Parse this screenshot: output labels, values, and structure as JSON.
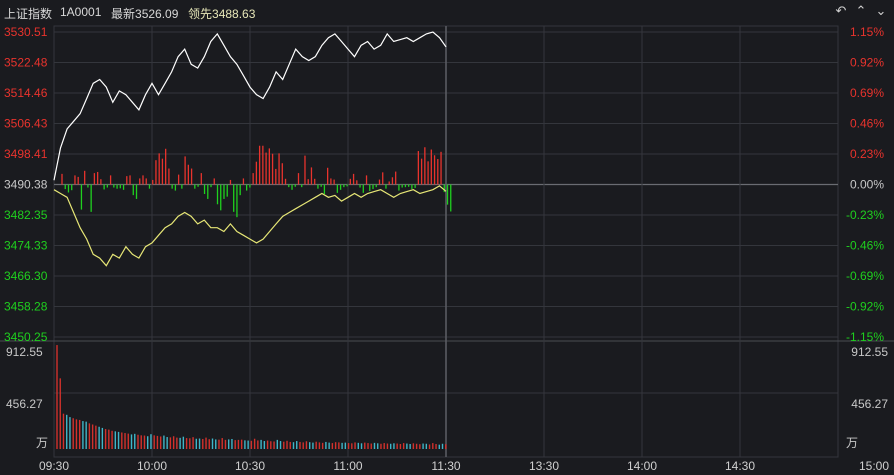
{
  "header": {
    "index_name": "上证指数",
    "code": "1A0001",
    "latest_label": "最新",
    "latest_value": "3526.09",
    "leading_label": "领先",
    "leading_value": "3488.63",
    "icons": [
      "undo-icon",
      "chevron-up-icon",
      "chevron-down-icon"
    ]
  },
  "colors": {
    "background": "#1a1b1f",
    "up": "#e8332d",
    "down": "#1fd01f",
    "price_line": "#ffffff",
    "leading_line": "#e6e676",
    "grid": "#34363c",
    "volume_up": "#d2312c",
    "volume_down": "#3fb6c8",
    "header_value": "#e7e7b8"
  },
  "chart_data": {
    "type": "line",
    "price_axis": {
      "ticks": [
        "3530.51",
        "3522.48",
        "3514.46",
        "3506.43",
        "3498.41",
        "3490.38",
        "3482.35",
        "3474.33",
        "3466.30",
        "3458.28",
        "3450.25"
      ],
      "ylim": [
        3450.25,
        3530.51
      ],
      "prev_close": 3490.38
    },
    "percent_axis": {
      "ticks": [
        "1.15%",
        "0.92%",
        "0.69%",
        "0.46%",
        "0.23%",
        "0.00%",
        "-0.23%",
        "-0.46%",
        "-0.69%",
        "-0.92%",
        "-1.15%"
      ]
    },
    "volume_axis": {
      "ticks": [
        "912.55",
        "456.27"
      ],
      "ylim": [
        0,
        912.55
      ],
      "unit": "万"
    },
    "time_axis": {
      "labels": [
        "09:30",
        "10:00",
        "10:30",
        "11:00",
        "11:30",
        "13:30",
        "14:00",
        "14:30",
        "15:00"
      ],
      "total_minutes": 240
    },
    "series": [
      {
        "key": "price",
        "points": [
          [
            0,
            3491.5
          ],
          [
            2,
            3500
          ],
          [
            4,
            3505
          ],
          [
            6,
            3507
          ],
          [
            8,
            3509
          ],
          [
            10,
            3513
          ],
          [
            12,
            3517
          ],
          [
            14,
            3518
          ],
          [
            16,
            3516
          ],
          [
            18,
            3512
          ],
          [
            20,
            3515
          ],
          [
            22,
            3514
          ],
          [
            24,
            3512
          ],
          [
            26,
            3510
          ],
          [
            28,
            3514
          ],
          [
            30,
            3517
          ],
          [
            32,
            3514
          ],
          [
            34,
            3517
          ],
          [
            36,
            3520
          ],
          [
            38,
            3524
          ],
          [
            40,
            3526
          ],
          [
            42,
            3522
          ],
          [
            44,
            3521
          ],
          [
            46,
            3524
          ],
          [
            48,
            3528
          ],
          [
            50,
            3530
          ],
          [
            52,
            3527
          ],
          [
            54,
            3524
          ],
          [
            56,
            3522
          ],
          [
            58,
            3519
          ],
          [
            60,
            3516
          ],
          [
            62,
            3514
          ],
          [
            64,
            3513
          ],
          [
            66,
            3516
          ],
          [
            68,
            3520
          ],
          [
            70,
            3518
          ],
          [
            72,
            3522
          ],
          [
            74,
            3526
          ],
          [
            76,
            3524
          ],
          [
            78,
            3523
          ],
          [
            80,
            3524
          ],
          [
            82,
            3527
          ],
          [
            84,
            3529
          ],
          [
            86,
            3530
          ],
          [
            88,
            3528
          ],
          [
            90,
            3526
          ],
          [
            92,
            3524
          ],
          [
            94,
            3527
          ],
          [
            96,
            3528
          ],
          [
            98,
            3526
          ],
          [
            100,
            3527
          ],
          [
            102,
            3530
          ],
          [
            104,
            3528
          ],
          [
            106,
            3528.5
          ],
          [
            108,
            3529
          ],
          [
            110,
            3528
          ],
          [
            112,
            3529
          ],
          [
            114,
            3530
          ],
          [
            116,
            3530.5
          ],
          [
            118,
            3529
          ],
          [
            120,
            3526.6
          ]
        ]
      },
      {
        "key": "leading",
        "points": [
          [
            0,
            3489
          ],
          [
            2,
            3488
          ],
          [
            4,
            3487
          ],
          [
            6,
            3483
          ],
          [
            8,
            3479
          ],
          [
            10,
            3476
          ],
          [
            12,
            3472
          ],
          [
            14,
            3471
          ],
          [
            16,
            3469
          ],
          [
            18,
            3472
          ],
          [
            20,
            3471
          ],
          [
            22,
            3474
          ],
          [
            24,
            3472
          ],
          [
            26,
            3471
          ],
          [
            28,
            3474
          ],
          [
            30,
            3475
          ],
          [
            32,
            3477
          ],
          [
            34,
            3479
          ],
          [
            36,
            3480
          ],
          [
            38,
            3482
          ],
          [
            40,
            3483
          ],
          [
            42,
            3482
          ],
          [
            44,
            3480
          ],
          [
            46,
            3481
          ],
          [
            48,
            3479
          ],
          [
            50,
            3479
          ],
          [
            52,
            3478
          ],
          [
            54,
            3480
          ],
          [
            56,
            3478
          ],
          [
            58,
            3477
          ],
          [
            60,
            3476
          ],
          [
            62,
            3475
          ],
          [
            64,
            3476
          ],
          [
            66,
            3478
          ],
          [
            68,
            3480
          ],
          [
            70,
            3482
          ],
          [
            72,
            3483
          ],
          [
            74,
            3484
          ],
          [
            76,
            3485
          ],
          [
            78,
            3486
          ],
          [
            80,
            3487
          ],
          [
            82,
            3488
          ],
          [
            84,
            3487
          ],
          [
            86,
            3487.5
          ],
          [
            88,
            3486
          ],
          [
            90,
            3487
          ],
          [
            92,
            3488
          ],
          [
            94,
            3487
          ],
          [
            96,
            3488
          ],
          [
            98,
            3488.5
          ],
          [
            100,
            3489
          ],
          [
            102,
            3488
          ],
          [
            104,
            3487
          ],
          [
            106,
            3488
          ],
          [
            108,
            3488.5
          ],
          [
            110,
            3489
          ],
          [
            112,
            3488
          ],
          [
            114,
            3488.5
          ],
          [
            116,
            3489
          ],
          [
            118,
            3490
          ],
          [
            120,
            3488.6
          ]
        ]
      }
    ],
    "diff_bars": [
      2.8,
      -1.2,
      -2.1,
      -1.5,
      2.4,
      2.0,
      -6.6,
      3.6,
      -0.8,
      -7.2,
      3.0,
      3.3,
      1.4,
      -1.3,
      -0.8,
      2.4,
      -0.8,
      -1.1,
      -1.0,
      -1.4,
      2.2,
      2.4,
      -2.8,
      -3.8,
      1.6,
      2.4,
      1.6,
      -1.1,
      1.2,
      6.4,
      8.2,
      6.8,
      9.4,
      4.2,
      -1.1,
      -1.6,
      2.6,
      -1.1,
      7.4,
      5.2,
      4.2,
      -1.1,
      -0.6,
      3.0,
      -2.5,
      -3.8,
      -0.7,
      1.6,
      -5.2,
      -6.8,
      -3.8,
      -3.2,
      1.2,
      -7.2,
      -8.6,
      -2.8,
      1.6,
      -1.6,
      -0.8,
      3.0,
      6.0,
      10.2,
      10.2,
      8.4,
      9.5,
      8.1,
      4.1,
      8.2,
      5.6,
      1.5,
      -0.7,
      -1.4,
      -0.6,
      3.0,
      -0.7,
      7.6,
      1.4,
      4.5,
      1.5,
      -1.1,
      -0.6,
      -2.5,
      4.4,
      1.6,
      1.3,
      -2.2,
      -1.4,
      -0.7,
      -0.5,
      1.5,
      2.8,
      1.1,
      -0.8,
      -2.2,
      2.4,
      -1.7,
      -1.2,
      -0.7,
      1.3,
      3.2,
      -1.1,
      0.8,
      1.9,
      3.4,
      -1.6,
      -0.8,
      -0.7,
      -0.6,
      -1.2,
      -0.9,
      8.8,
      6.8,
      9.8,
      6.1,
      9.2,
      7.7,
      6.7,
      8.6,
      -2.0,
      -5.3,
      -7.1
    ],
    "volume": [
      912,
      620,
      310,
      300,
      280,
      270,
      260,
      255,
      245,
      240,
      225,
      215,
      205,
      195,
      185,
      175,
      170,
      160,
      155,
      150,
      145,
      140,
      135,
      128,
      133,
      125,
      120,
      118,
      112,
      130,
      120,
      115,
      110,
      118,
      105,
      102,
      112,
      100,
      98,
      108,
      96,
      94,
      104,
      90,
      92,
      88,
      100,
      86,
      92,
      84,
      82,
      96,
      80,
      84,
      88,
      78,
      80,
      82,
      76,
      74,
      72,
      90,
      75,
      80,
      70,
      74,
      68,
      66,
      80,
      70,
      64,
      72,
      62,
      60,
      70,
      62,
      58,
      68,
      60,
      56,
      64,
      58,
      54,
      62,
      56,
      52,
      60,
      58,
      54,
      56,
      52,
      50,
      58,
      54,
      50,
      56,
      52,
      48,
      54,
      50,
      46,
      52,
      48,
      46,
      50,
      48,
      44,
      52,
      48,
      44,
      50,
      46,
      42,
      48,
      46,
      40,
      52,
      44,
      38,
      46,
      42
    ]
  }
}
